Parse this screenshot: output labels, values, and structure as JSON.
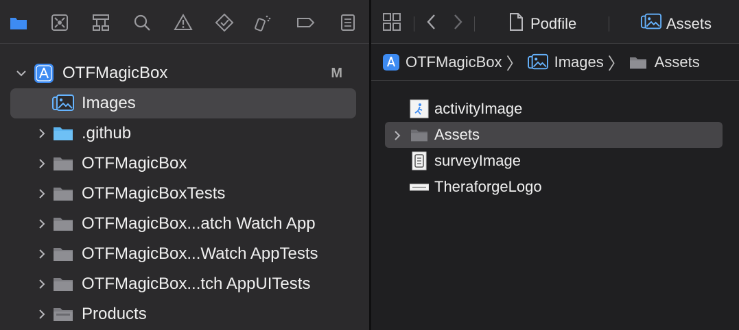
{
  "navigator": {
    "toolbar_icons": [
      "folder-icon",
      "source-control-icon",
      "hierarchy-icon",
      "search-icon",
      "warning-icon",
      "test-icon",
      "debug-icon",
      "breakpoint-icon",
      "report-icon"
    ],
    "project": {
      "name": "OTFMagicBox",
      "badge": "M"
    },
    "items": [
      {
        "label": "Images",
        "icon": "asset-catalog-icon",
        "expandable": false,
        "selected": true
      },
      {
        "label": ".github",
        "icon": "folder-blue-icon",
        "expandable": true
      },
      {
        "label": "OTFMagicBox",
        "icon": "folder-icon",
        "expandable": true
      },
      {
        "label": "OTFMagicBoxTests",
        "icon": "folder-icon",
        "expandable": true
      },
      {
        "label": "OTFMagicBox...atch Watch App",
        "icon": "folder-icon",
        "expandable": true
      },
      {
        "label": "OTFMagicBox...Watch AppTests",
        "icon": "folder-icon",
        "expandable": true
      },
      {
        "label": "OTFMagicBox...tch AppUITests",
        "icon": "folder-icon",
        "expandable": true
      },
      {
        "label": "Products",
        "icon": "folder-icon",
        "expandable": true
      }
    ]
  },
  "editor": {
    "tabs": [
      {
        "label": "Podfile",
        "icon": "document-icon"
      },
      {
        "label": "Assets",
        "icon": "asset-catalog-icon"
      }
    ],
    "jumpbar": [
      {
        "label": "OTFMagicBox",
        "icon": "app-icon"
      },
      {
        "label": "Images",
        "icon": "asset-catalog-icon"
      },
      {
        "label": "Assets",
        "icon": "folder-icon"
      }
    ],
    "assets": [
      {
        "label": "activityImage",
        "icon": "image-set-icon",
        "expandable": false
      },
      {
        "label": "Assets",
        "icon": "folder-icon",
        "expandable": true,
        "selected": true
      },
      {
        "label": "surveyImage",
        "icon": "image-set-icon",
        "expandable": false
      },
      {
        "label": "TheraforgeLogo",
        "icon": "image-set-icon",
        "expandable": false
      }
    ]
  },
  "colors": {
    "accent": "#3d8bf2",
    "folder_gray": "#8e8e93",
    "selection": "#464548"
  }
}
